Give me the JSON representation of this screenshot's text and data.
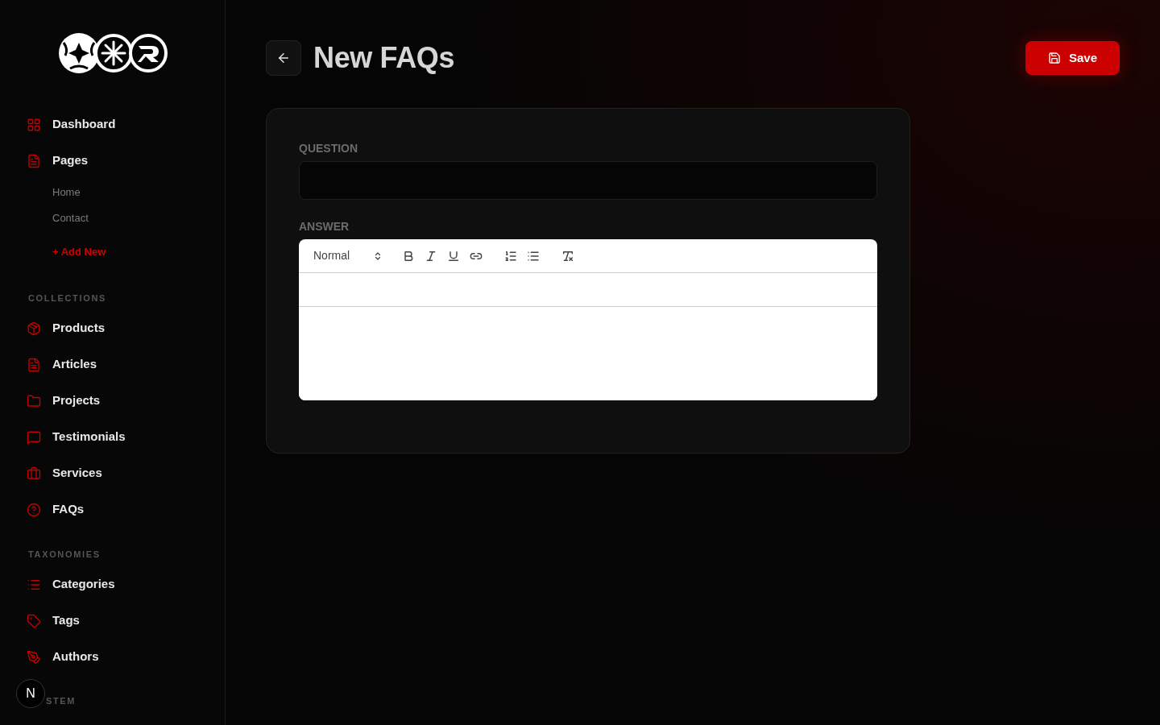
{
  "sidebar": {
    "main_items": [
      {
        "label": "Dashboard"
      },
      {
        "label": "Pages",
        "children": [
          {
            "label": "Home"
          },
          {
            "label": "Contact"
          }
        ],
        "add_link": "+ Add New"
      }
    ],
    "sections": [
      {
        "title": "COLLECTIONS",
        "items": [
          {
            "label": "Products"
          },
          {
            "label": "Articles"
          },
          {
            "label": "Projects"
          },
          {
            "label": "Testimonials"
          },
          {
            "label": "Services"
          },
          {
            "label": "FAQs"
          }
        ]
      },
      {
        "title": "TAXONOMIES",
        "items": [
          {
            "label": "Categories"
          },
          {
            "label": "Tags"
          },
          {
            "label": "Authors"
          }
        ]
      }
    ],
    "partial_section_title": "STEM",
    "corner_badge": {
      "label": "N"
    }
  },
  "header": {
    "title": "New FAQs",
    "save_button": "Save"
  },
  "form": {
    "fields": [
      {
        "kind": "text",
        "label": "QUESTION"
      },
      {
        "kind": "rich_text",
        "label": "ANSWER",
        "toolbar": {
          "format": "Normal"
        }
      }
    ]
  }
}
